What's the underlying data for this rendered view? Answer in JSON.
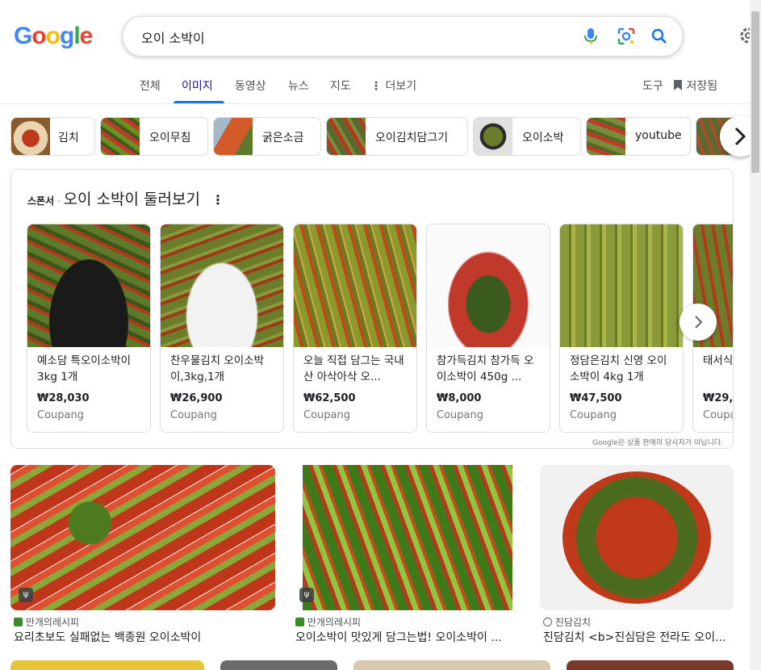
{
  "search": {
    "query": "오이 소박이"
  },
  "nav": {
    "tabs": [
      {
        "label": "전체"
      },
      {
        "label": "이미지"
      },
      {
        "label": "동영상"
      },
      {
        "label": "뉴스"
      },
      {
        "label": "지도"
      },
      {
        "label": "더보기"
      }
    ],
    "tools": "도구",
    "saved": "저장됨"
  },
  "chips": [
    {
      "label": "김치"
    },
    {
      "label": "오이무침"
    },
    {
      "label": "굵은소금"
    },
    {
      "label": "오이김치담그기"
    },
    {
      "label": "오이소박"
    },
    {
      "label": "youtube"
    }
  ],
  "sponsored": {
    "tag": "스폰서",
    "title": "오이 소박이 둘러보기",
    "products": [
      {
        "name": "예소담 특오이소박이 3kg 1개",
        "price": "₩28,030",
        "store": "Coupang"
      },
      {
        "name": "찬우물김치 오이소박이,3kg,1개",
        "price": "₩26,900",
        "store": "Coupang"
      },
      {
        "name": "오늘 직접 담그는 국내산 아삭아삭 오...",
        "price": "₩62,500",
        "store": "Coupang"
      },
      {
        "name": "참가득김치 참가득 오이소박이 450g ...",
        "price": "₩8,000",
        "store": "Coupang"
      },
      {
        "name": "정담은김치 신영 오이소박이 4kg 1개",
        "price": "₩47,500",
        "store": "Coupang"
      },
      {
        "name": "태서식 오이소",
        "price": "₩29,7",
        "store": "Coupa"
      }
    ],
    "disclaimer": "Google은 상품 판매의 당사자가 아닙니다."
  },
  "results": [
    {
      "source": "만개의레시피",
      "title": "요리초보도 실패없는 백종원 오이소박이"
    },
    {
      "source": "만개의레시피",
      "title": "오이소박이 맛있게 담그는법! 오이소박이 ..."
    },
    {
      "source": "진담김치",
      "title": "진담김치 <b>진심담은 전라도 오이..."
    }
  ],
  "colors": {
    "accent": "#1a73e8",
    "link": "#1a0dab"
  }
}
